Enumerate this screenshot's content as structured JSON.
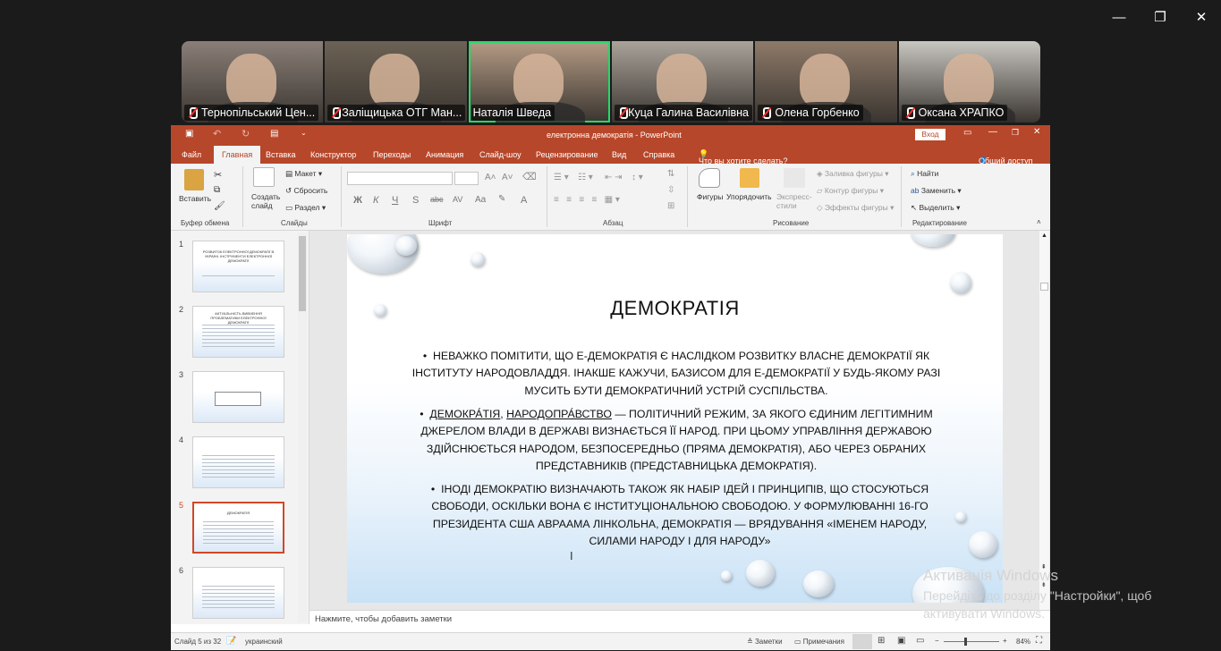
{
  "window_controls": {
    "minimize": "—",
    "restore": "❐",
    "close": "✕"
  },
  "participants": [
    {
      "name": "Тернопільський Цен...",
      "muted": true,
      "active": false,
      "bg": "#8a7f78"
    },
    {
      "name": "Заліщицька ОТГ Ман...",
      "muted": true,
      "active": false,
      "bg": "#6c6255"
    },
    {
      "name": "Наталія Шведа",
      "muted": false,
      "active": true,
      "bg": "#b69c85"
    },
    {
      "name": "Куца Галина Василівна",
      "muted": true,
      "active": false,
      "bg": "#a9a39a"
    },
    {
      "name": "Олена Горбенко",
      "muted": true,
      "active": false,
      "bg": "#8e7a69"
    },
    {
      "name": "Оксана ХРАПКО",
      "muted": true,
      "active": false,
      "bg": "#c8c6c0"
    }
  ],
  "ppt": {
    "title": "електронна демократія  -  PowerPoint",
    "signin": "Вход",
    "menu": [
      "Файл",
      "Главная",
      "Вставка",
      "Конструктор",
      "Переходы",
      "Анимация",
      "Слайд-шоу",
      "Рецензирование",
      "Вид",
      "Справка"
    ],
    "tell_me": "Что вы хотите сделать?",
    "share": "Общий доступ",
    "ribbon": {
      "paste": "Вставить",
      "clipboard": "Буфер обмена",
      "new_slide": "Создать слайд",
      "layout": "Макет",
      "reset": "Сбросить",
      "section": "Раздел",
      "slides": "Слайды",
      "font": "Шрифт",
      "bold": "Ж",
      "italic": "К",
      "underline": "Ч",
      "strike": "S",
      "spacing": "AV",
      "case": "Aa",
      "fontcolor": "A",
      "paragraph": "Абзац",
      "shapes": "Фигуры",
      "arrange": "Упорядочить",
      "express": "Экспресс-стили",
      "fill": "Заливка фигуры",
      "outline": "Контур фигуры",
      "effects": "Эффекты фигуры",
      "drawing": "Рисование",
      "find": "Найти",
      "replace": "Заменить",
      "select": "Выделить",
      "editing": "Редактирование"
    },
    "thumbnails": [
      "1",
      "2",
      "3",
      "4",
      "5",
      "6"
    ],
    "thumb1_text": "РОЗВИТОК ЕЛЕКТРОННОЇ ДЕМОКРАТІЇ В УКРАЇНІ. ІНСТРУМЕНТИ ЕЛЕКТРОННОЇ ДЕМОКРАТІЇ",
    "thumb2_text": "АКТУАЛЬНІСТЬ ВИВЧЕННЯ ПРОБЛЕМАТИКИ ЕЛЕКТРОННОЇ ДЕМОКРАТІЇ",
    "thumb5_text": "ДЕМОКРАТІЯ",
    "slide": {
      "title": "ДЕМОКРАТІЯ",
      "bullet1": "НЕВАЖКО ПОМІТИТИ, ЩО Е-ДЕМОКРАТІЯ Є НАСЛІДКОМ РОЗВИТКУ ВЛАСНЕ ДЕМОКРАТІЇ ЯК ІНСТИТУТУ НАРОДОВЛАДДЯ. ІНАКШЕ КАЖУЧИ, БАЗИСОМ ДЛЯ Е-ДЕМОКРАТІЇ У БУДЬ-ЯКОМУ РАЗІ МУСИТЬ БУТИ ДЕМОКРАТИЧНИЙ УСТРІЙ СУСПІЛЬСТВА.",
      "bullet2_a": "ДЕМОКРА́ТІЯ",
      "bullet2_b": "НАРОДОПРА́ВСТВО",
      "bullet2_c": "— ПОЛІТИЧНИЙ РЕЖИМ, ЗА ЯКОГО ЄДИНИМ ЛЕГІТИМНИМ ДЖЕРЕЛОМ ВЛАДИ В ДЕРЖАВІ ВИЗНАЄТЬСЯ ЇЇ НАРОД. ПРИ ЦЬОМУ УПРАВЛІННЯ ДЕРЖАВОЮ ЗДІЙСНЮЄТЬСЯ НАРОДОМ, БЕЗПОСЕРЕДНЬО (ПРЯМА ДЕМОКРАТІЯ), АБО ЧЕРЕЗ ОБРАНИХ ПРЕДСТАВНИКІВ (ПРЕДСТАВНИЦЬКА ДЕМОКРАТІЯ).",
      "bullet3": "ІНОДІ ДЕМОКРАТІЮ ВИЗНАЧАЮТЬ ТАКОЖ ЯК НАБІР ІДЕЙ І ПРИНЦИПІВ, ЩО СТОСУЮТЬСЯ СВОБОДИ, ОСКІЛЬКИ ВОНА Є ІНСТИТУЦІОНАЛЬНОЮ СВОБОДОЮ. У ФОРМУЛЮВАННІ 16-ГО ПРЕЗИДЕНТА США АВРААМА ЛІНКОЛЬНА, ДЕМОКРАТІЯ — ВРЯДУВАННЯ «ІМЕНЕМ НАРОДУ, СИЛАМИ НАРОДУ І ДЛЯ НАРОДУ»"
    },
    "notes_placeholder": "Нажмите, чтобы добавить заметки",
    "status": {
      "slide_of": "Слайд 5 из 32",
      "language": "украинский",
      "notes": "Заметки",
      "comments": "Примечания",
      "zoom": "84%"
    }
  },
  "activation": {
    "title": "Активація Windows",
    "line1": "Перейдіть до розділу \"Настройки\", щоб",
    "line2": "активувати Windows."
  }
}
